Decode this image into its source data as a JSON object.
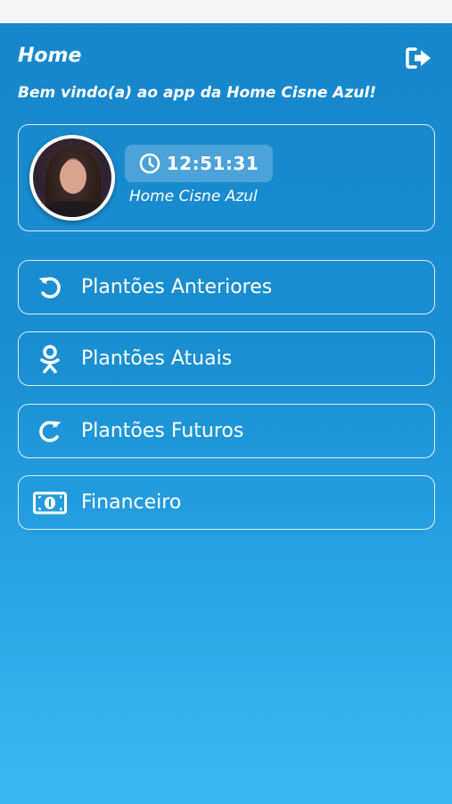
{
  "header": {
    "title": "Home",
    "welcome": "Bem vindo(a) ao app da Home Cisne Azul!"
  },
  "profile": {
    "time": "12:51:31",
    "company": "Home Cisne Azul"
  },
  "menu": [
    {
      "label": "Plantões Anteriores",
      "icon": "undo-icon"
    },
    {
      "label": "Plantões Atuais",
      "icon": "odnoklassniki-icon"
    },
    {
      "label": "Plantões Futuros",
      "icon": "redo-icon"
    },
    {
      "label": "Financeiro",
      "icon": "money-bill-icon"
    }
  ],
  "colors": {
    "background_top": "#1886cc",
    "background_bottom": "#3ab8f2",
    "text": "#ffffff"
  }
}
